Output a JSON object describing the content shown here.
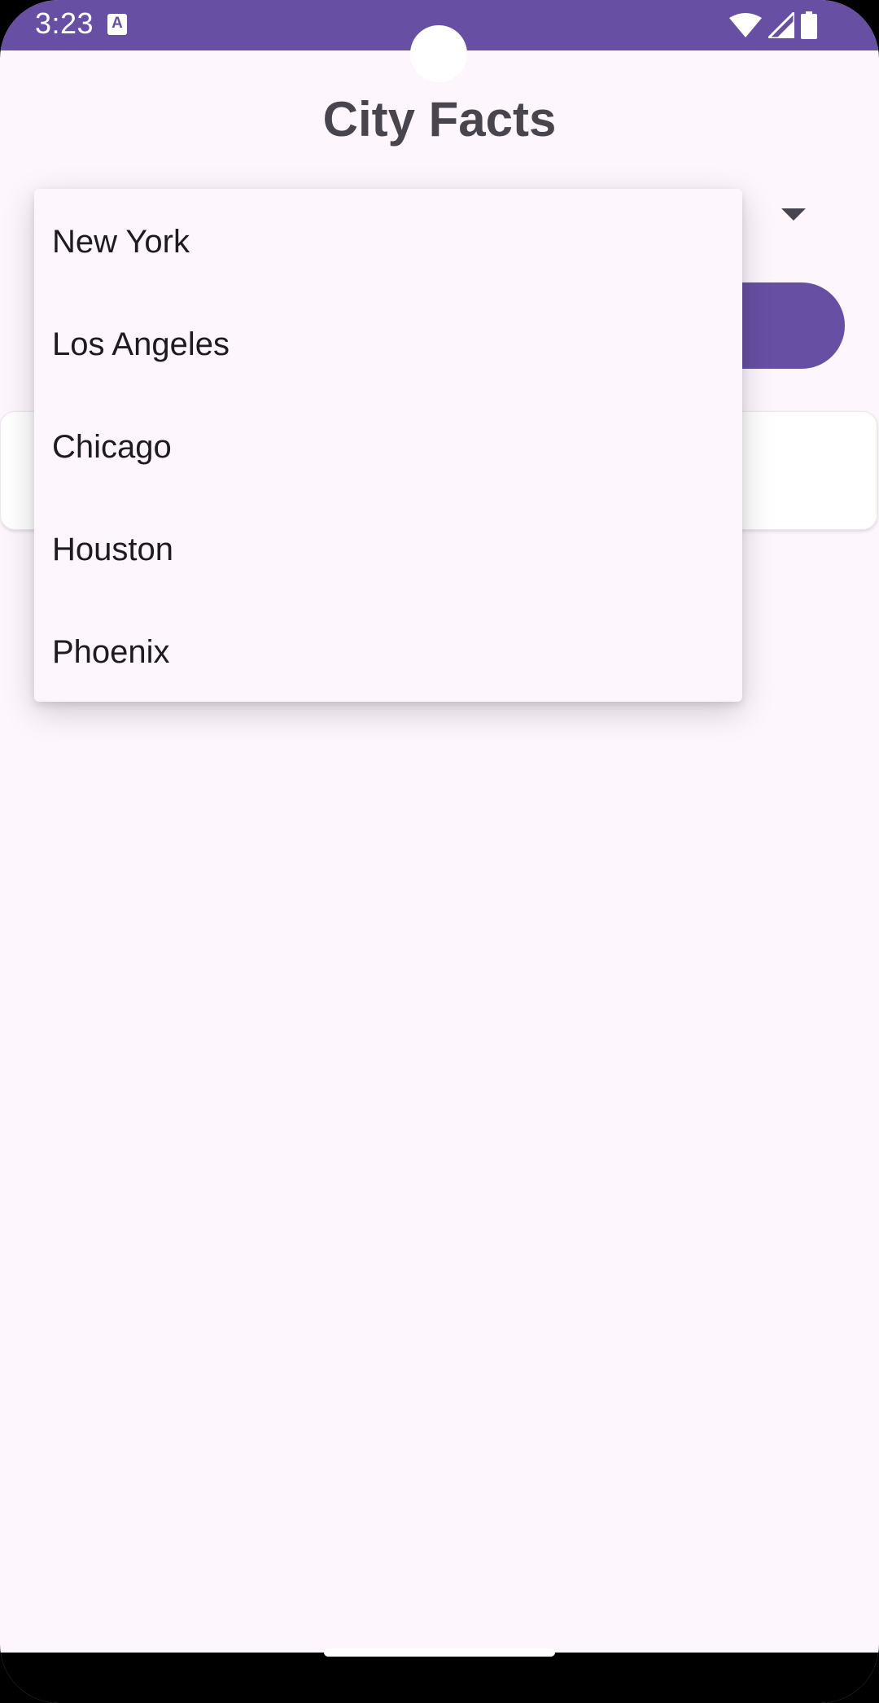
{
  "status_bar": {
    "time": "3:23",
    "notification_icon": "a-icon",
    "wifi_icon": "wifi-icon",
    "signal_icon": "signal-icon",
    "battery_icon": "battery-icon",
    "color": "#6750a4"
  },
  "app": {
    "title": "City Facts"
  },
  "dropdown": {
    "icon": "dropdown-arrow-icon",
    "options": [
      "New York",
      "Los Angeles",
      "Chicago",
      "Houston",
      "Phoenix"
    ]
  },
  "colors": {
    "primary": "#6750a4",
    "background": "#fdf6fd",
    "text": "#1d1b20",
    "title": "#48454e"
  }
}
